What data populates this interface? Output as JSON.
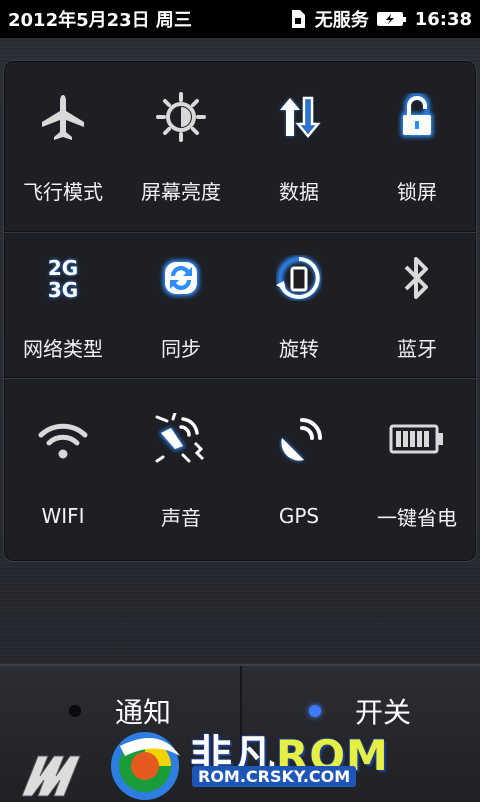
{
  "status_bar": {
    "date": "2012年5月23日 周三",
    "carrier": "无服务",
    "time": "16:38"
  },
  "tiles": [
    {
      "label": "飞行模式",
      "icon": "airplane-icon",
      "state": "off"
    },
    {
      "label": "屏幕亮度",
      "icon": "brightness-icon",
      "state": "off"
    },
    {
      "label": "数据",
      "icon": "data-transfer-icon",
      "state": "on"
    },
    {
      "label": "锁屏",
      "icon": "lock-icon",
      "state": "on"
    },
    {
      "label": "网络类型",
      "icon": "network-type-icon",
      "icon_text": [
        "2G",
        "3G"
      ],
      "state": "on"
    },
    {
      "label": "同步",
      "icon": "sync-icon",
      "state": "on"
    },
    {
      "label": "旋转",
      "icon": "rotate-icon",
      "state": "on"
    },
    {
      "label": "蓝牙",
      "icon": "bluetooth-icon",
      "state": "off"
    },
    {
      "label": "WIFI",
      "icon": "wifi-icon",
      "state": "off"
    },
    {
      "label": "声音",
      "icon": "sound-icon",
      "state": "on"
    },
    {
      "label": "GPS",
      "icon": "gps-icon",
      "state": "on"
    },
    {
      "label": "一键省电",
      "icon": "battery-saver-icon",
      "state": "off"
    }
  ],
  "tabs": {
    "notifications_label": "通知",
    "switches_label": "开关",
    "active": "switches"
  },
  "watermark": {
    "text_cn": "非凡",
    "text_rom": "ROM",
    "url": "ROM.CRSKY.COM"
  },
  "colors": {
    "active_blue": "#2f8cff",
    "inactive_gray": "#d8d8d8",
    "panel_bg": "#1d1f25"
  }
}
